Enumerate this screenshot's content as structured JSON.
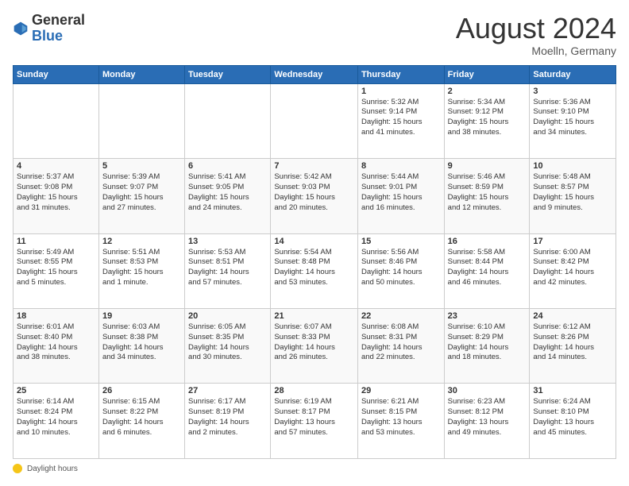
{
  "header": {
    "logo_general": "General",
    "logo_blue": "Blue",
    "month_title": "August 2024",
    "location": "Moelln, Germany"
  },
  "footer": {
    "label": "Daylight hours"
  },
  "weekdays": [
    "Sunday",
    "Monday",
    "Tuesday",
    "Wednesday",
    "Thursday",
    "Friday",
    "Saturday"
  ],
  "rows": [
    {
      "cells": [
        {
          "day": "",
          "info": ""
        },
        {
          "day": "",
          "info": ""
        },
        {
          "day": "",
          "info": ""
        },
        {
          "day": "",
          "info": ""
        },
        {
          "day": "1",
          "info": "Sunrise: 5:32 AM\nSunset: 9:14 PM\nDaylight: 15 hours\nand 41 minutes."
        },
        {
          "day": "2",
          "info": "Sunrise: 5:34 AM\nSunset: 9:12 PM\nDaylight: 15 hours\nand 38 minutes."
        },
        {
          "day": "3",
          "info": "Sunrise: 5:36 AM\nSunset: 9:10 PM\nDaylight: 15 hours\nand 34 minutes."
        }
      ]
    },
    {
      "cells": [
        {
          "day": "4",
          "info": "Sunrise: 5:37 AM\nSunset: 9:08 PM\nDaylight: 15 hours\nand 31 minutes."
        },
        {
          "day": "5",
          "info": "Sunrise: 5:39 AM\nSunset: 9:07 PM\nDaylight: 15 hours\nand 27 minutes."
        },
        {
          "day": "6",
          "info": "Sunrise: 5:41 AM\nSunset: 9:05 PM\nDaylight: 15 hours\nand 24 minutes."
        },
        {
          "day": "7",
          "info": "Sunrise: 5:42 AM\nSunset: 9:03 PM\nDaylight: 15 hours\nand 20 minutes."
        },
        {
          "day": "8",
          "info": "Sunrise: 5:44 AM\nSunset: 9:01 PM\nDaylight: 15 hours\nand 16 minutes."
        },
        {
          "day": "9",
          "info": "Sunrise: 5:46 AM\nSunset: 8:59 PM\nDaylight: 15 hours\nand 12 minutes."
        },
        {
          "day": "10",
          "info": "Sunrise: 5:48 AM\nSunset: 8:57 PM\nDaylight: 15 hours\nand 9 minutes."
        }
      ]
    },
    {
      "cells": [
        {
          "day": "11",
          "info": "Sunrise: 5:49 AM\nSunset: 8:55 PM\nDaylight: 15 hours\nand 5 minutes."
        },
        {
          "day": "12",
          "info": "Sunrise: 5:51 AM\nSunset: 8:53 PM\nDaylight: 15 hours\nand 1 minute."
        },
        {
          "day": "13",
          "info": "Sunrise: 5:53 AM\nSunset: 8:51 PM\nDaylight: 14 hours\nand 57 minutes."
        },
        {
          "day": "14",
          "info": "Sunrise: 5:54 AM\nSunset: 8:48 PM\nDaylight: 14 hours\nand 53 minutes."
        },
        {
          "day": "15",
          "info": "Sunrise: 5:56 AM\nSunset: 8:46 PM\nDaylight: 14 hours\nand 50 minutes."
        },
        {
          "day": "16",
          "info": "Sunrise: 5:58 AM\nSunset: 8:44 PM\nDaylight: 14 hours\nand 46 minutes."
        },
        {
          "day": "17",
          "info": "Sunrise: 6:00 AM\nSunset: 8:42 PM\nDaylight: 14 hours\nand 42 minutes."
        }
      ]
    },
    {
      "cells": [
        {
          "day": "18",
          "info": "Sunrise: 6:01 AM\nSunset: 8:40 PM\nDaylight: 14 hours\nand 38 minutes."
        },
        {
          "day": "19",
          "info": "Sunrise: 6:03 AM\nSunset: 8:38 PM\nDaylight: 14 hours\nand 34 minutes."
        },
        {
          "day": "20",
          "info": "Sunrise: 6:05 AM\nSunset: 8:35 PM\nDaylight: 14 hours\nand 30 minutes."
        },
        {
          "day": "21",
          "info": "Sunrise: 6:07 AM\nSunset: 8:33 PM\nDaylight: 14 hours\nand 26 minutes."
        },
        {
          "day": "22",
          "info": "Sunrise: 6:08 AM\nSunset: 8:31 PM\nDaylight: 14 hours\nand 22 minutes."
        },
        {
          "day": "23",
          "info": "Sunrise: 6:10 AM\nSunset: 8:29 PM\nDaylight: 14 hours\nand 18 minutes."
        },
        {
          "day": "24",
          "info": "Sunrise: 6:12 AM\nSunset: 8:26 PM\nDaylight: 14 hours\nand 14 minutes."
        }
      ]
    },
    {
      "cells": [
        {
          "day": "25",
          "info": "Sunrise: 6:14 AM\nSunset: 8:24 PM\nDaylight: 14 hours\nand 10 minutes."
        },
        {
          "day": "26",
          "info": "Sunrise: 6:15 AM\nSunset: 8:22 PM\nDaylight: 14 hours\nand 6 minutes."
        },
        {
          "day": "27",
          "info": "Sunrise: 6:17 AM\nSunset: 8:19 PM\nDaylight: 14 hours\nand 2 minutes."
        },
        {
          "day": "28",
          "info": "Sunrise: 6:19 AM\nSunset: 8:17 PM\nDaylight: 13 hours\nand 57 minutes."
        },
        {
          "day": "29",
          "info": "Sunrise: 6:21 AM\nSunset: 8:15 PM\nDaylight: 13 hours\nand 53 minutes."
        },
        {
          "day": "30",
          "info": "Sunrise: 6:23 AM\nSunset: 8:12 PM\nDaylight: 13 hours\nand 49 minutes."
        },
        {
          "day": "31",
          "info": "Sunrise: 6:24 AM\nSunset: 8:10 PM\nDaylight: 13 hours\nand 45 minutes."
        }
      ]
    }
  ]
}
